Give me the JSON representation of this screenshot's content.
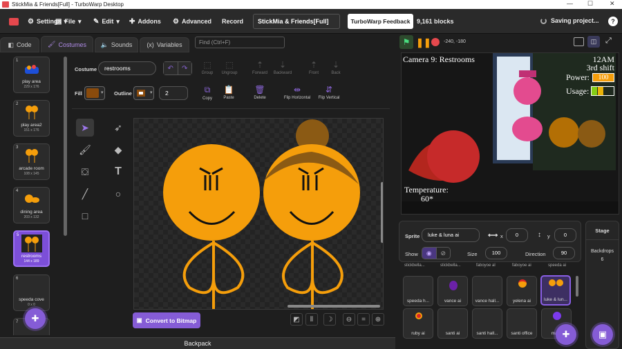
{
  "window": {
    "title": "StickMia & Friends[Full] - TurboWarp Desktop",
    "minimize": "—",
    "maximize": "☐",
    "close": "✕"
  },
  "menu": {
    "settings": "Settings",
    "file": "File",
    "edit": "Edit",
    "addons": "Addons",
    "advanced": "Advanced",
    "record": "Record",
    "project_title": "StickMia & Friends[Full]",
    "feedback": "TurboWarp Feedback",
    "blocks": "9,161 blocks",
    "saving": "Saving project...",
    "help": "?"
  },
  "tabs": {
    "code": "Code",
    "costumes": "Costumes",
    "sounds": "Sounds",
    "variables": "Variables"
  },
  "find": {
    "placeholder": "Find (Ctrl+F)"
  },
  "costumes": [
    {
      "num": "1",
      "name": "play area",
      "size": "229 x 176"
    },
    {
      "num": "2",
      "name": "play area2",
      "size": "151 x 176"
    },
    {
      "num": "3",
      "name": "arcade room",
      "size": "108 x 145"
    },
    {
      "num": "4",
      "name": "dining area",
      "size": "203 x 132"
    },
    {
      "num": "5",
      "name": "restrooms",
      "size": "144 x 189"
    },
    {
      "num": "6",
      "name": "speeda cove",
      "size": "0 x 0"
    },
    {
      "num": "7",
      "name": "",
      "size": ""
    }
  ],
  "editor": {
    "costume_label": "Costume",
    "costume_name": "restrooms",
    "fill_label": "Fill",
    "outline_label": "Outline",
    "outline_width": "2",
    "group": "Group",
    "ungroup": "Ungroup",
    "forward": "Forward",
    "backward": "Backward",
    "front": "Front",
    "back": "Back",
    "copy": "Copy",
    "paste": "Paste",
    "delete": "Delete",
    "flip_h": "Flip Horizontal",
    "flip_v": "Flip Vertical",
    "convert": "Convert to Bitmap",
    "fill_color": "#8a4b0c",
    "outline_color": "#ffffff"
  },
  "stage": {
    "coords": "-240, -180",
    "camera": "Camera 9: Restrooms",
    "time": "12AM",
    "shift": "3rd shift",
    "power_label": "Power:",
    "power_value": "100",
    "usage_label": "Usage:",
    "temp_label": "Temperature:",
    "temp_value": "60*"
  },
  "sprite": {
    "label": "Sprite",
    "name": "luke & luna ai",
    "x_label": "x",
    "x": "0",
    "y_label": "y",
    "y": "0",
    "show_label": "Show",
    "size_label": "Size",
    "size": "100",
    "direction_label": "Direction",
    "direction": "90"
  },
  "sprite_tiles": [
    {
      "name": "speeda h..."
    },
    {
      "name": "vance ai"
    },
    {
      "name": "vance hall..."
    },
    {
      "name": "yelena ai"
    },
    {
      "name": "luke & lun..."
    },
    {
      "name": "ruby ai"
    },
    {
      "name": "santi ai"
    },
    {
      "name": "santi hall..."
    },
    {
      "name": "santi office"
    },
    {
      "name": "ma..."
    }
  ],
  "sprite_row_partial": [
    "stickbella...",
    "stickbella...",
    "faboyoe al",
    "faboyoe ai",
    "speeda ai"
  ],
  "stage_panel": {
    "title": "Stage",
    "backdrops_label": "Backdrops",
    "backdrops_count": "6"
  },
  "backpack": "Backpack"
}
